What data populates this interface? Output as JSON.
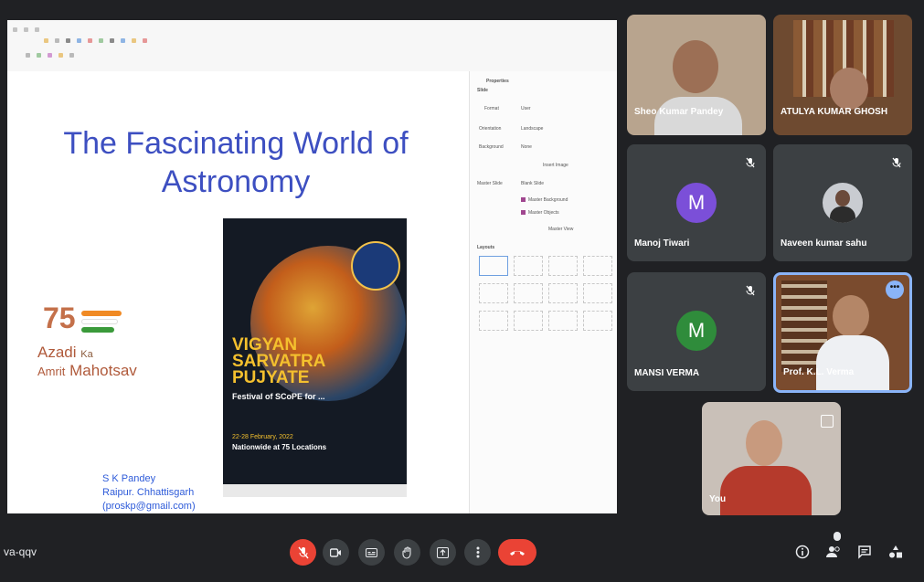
{
  "slide": {
    "title": "The Fascinating World of Astronomy",
    "author_name": "S K Pandey",
    "author_location": "Raipur. Chhattisgarh",
    "author_email": "(proskp@gmail.com)",
    "azadi_number": "75",
    "azadi_line1": "Azadi",
    "azadi_ka": "Ka",
    "azadi_line2a": "Amrit",
    "azadi_line2b": "Mahotsav"
  },
  "poster": {
    "title": "VIGYAN\nSARVATRA\nPUJYATE",
    "subtitle": "Festival of SCoPE for ...",
    "date": "22-28 February, 2022",
    "locations": "Nationwide at 75 Locations"
  },
  "properties_panel": {
    "heading": "Properties",
    "section_slide": "Slide",
    "format_label": "Format",
    "format_value": "User",
    "orientation_label": "Orientation",
    "orientation_value": "Landscape",
    "background_label": "Background",
    "background_value": "None",
    "insert_image": "Insert Image",
    "master_slide_label": "Master Slide",
    "master_slide_value": "Blank Slide",
    "master_background": "Master Background",
    "master_objects": "Master Objects",
    "master_view": "Master View",
    "section_layouts": "Layouts"
  },
  "participants": [
    {
      "name": "Sheo Kumar Pandey",
      "video": true,
      "muted": false
    },
    {
      "name": "ATULYA KUMAR GHOSH",
      "video": true,
      "muted": false
    },
    {
      "name": "Manoj Tiwari",
      "initial": "M",
      "avatar_color": "#7b4fd8",
      "muted": true
    },
    {
      "name": "Naveen kumar sahu",
      "muted": true
    },
    {
      "name": "MANSI VERMA",
      "initial": "M",
      "avatar_color": "#2f8c3b",
      "muted": true
    },
    {
      "name": "Prof. K.L. Verma",
      "video": true,
      "active_speaker": true,
      "muted": false
    },
    {
      "name": "You",
      "video": true,
      "muted": false
    }
  ],
  "bottom_bar": {
    "meeting_code": "va-qqv",
    "controls": [
      "mic-off-icon",
      "camera-icon",
      "captions-icon",
      "raise-hand-icon",
      "present-icon",
      "more-options-icon",
      "end-call-icon"
    ],
    "right_icons": [
      "info-icon",
      "people-icon",
      "chat-icon",
      "activities-icon"
    ]
  },
  "colors": {
    "background": "#202124",
    "tile": "#3c4043",
    "end_call": "#ea4335",
    "title_blue": "#3d4fc1",
    "active_border": "#8ab4f8"
  }
}
